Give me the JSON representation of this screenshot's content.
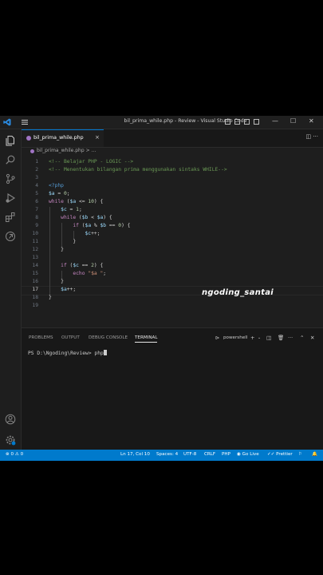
{
  "window": {
    "title": "bil_prima_while.php - Review - Visual Studio Code",
    "controls": {
      "minimize": "—",
      "maximize": "☐",
      "close": "✕"
    }
  },
  "tab": {
    "label": "bil_prima_while.php",
    "close": "×"
  },
  "breadcrumb": {
    "label": "bil_prima_while.php > ..."
  },
  "editor": {
    "current_line": 17,
    "lines": [
      "<!-- Belajar PHP - LOGIC -->",
      "<!-- Menentukan bilangan prima menggunakan sintaks WHILE-->",
      "",
      "<?php",
      "$a = 0;",
      "while ($a <= 10) {",
      "    $c = 1;",
      "    while ($b < $a) {",
      "        if ($a % $b == 0) {",
      "            $c++;",
      "        }",
      "    }",
      "",
      "    if ($c == 2) {",
      "        echo \"$a \";",
      "    }",
      "    $a++;",
      "}",
      ""
    ]
  },
  "watermark": "ngoding_santai",
  "panel": {
    "tabs": [
      "PROBLEMS",
      "OUTPUT",
      "DEBUG CONSOLE",
      "TERMINAL"
    ],
    "active_tab": "TERMINAL",
    "shell": "powershell",
    "prompt": "PS D:\\Ngoding\\Review> ",
    "command": "php"
  },
  "status": {
    "errors": "0",
    "warnings": "0",
    "position": "Ln 17, Col 10",
    "spaces": "Spaces: 4",
    "encoding": "UTF-8",
    "eol": "CRLF",
    "language": "PHP",
    "golive": "Go Live",
    "prettier": "Prettier"
  },
  "colors": {
    "statusbar": "#007acc",
    "comment": "#6a9955",
    "keyword": "#c586c0",
    "variable": "#9cdcfe",
    "number": "#b5cea8",
    "string": "#ce9178",
    "php_tag": "#569cd6"
  }
}
